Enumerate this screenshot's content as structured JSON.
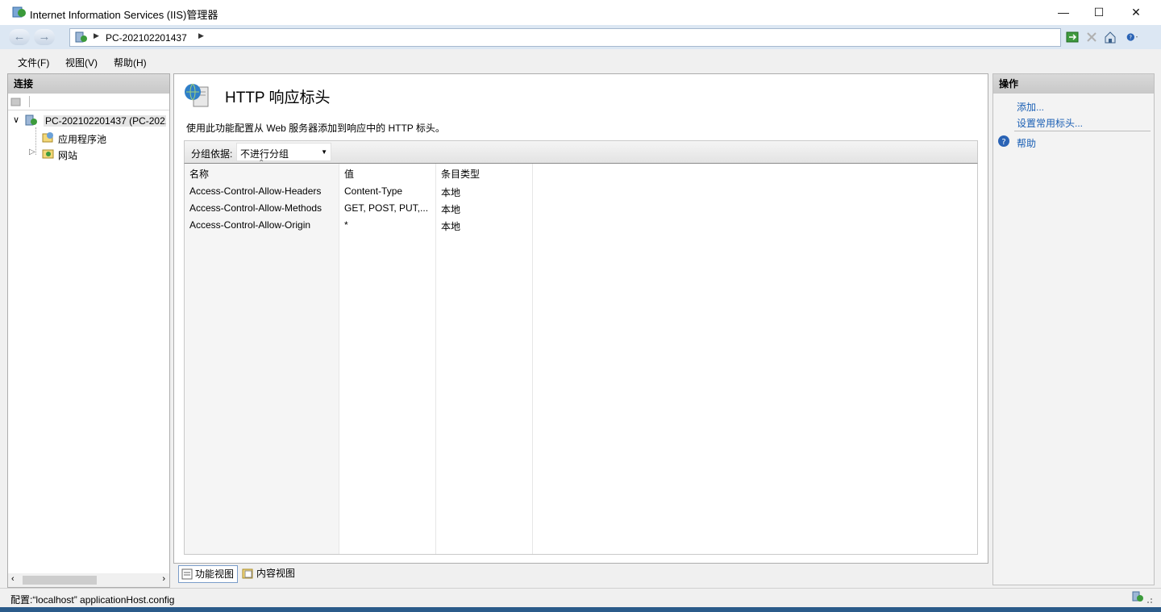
{
  "window": {
    "title": "Internet Information Services (IIS)管理器"
  },
  "address": {
    "crumb": "PC-202102201437"
  },
  "menu": {
    "file": "文件(F)",
    "view": "视图(V)",
    "help": "帮助(H)"
  },
  "connections": {
    "header": "连接",
    "tree": [
      {
        "label": "PC-202102201437 (PC-2021"
      },
      {
        "label": "应用程序池"
      },
      {
        "label": "网站"
      }
    ]
  },
  "feature": {
    "title": "HTTP 响应标头",
    "description": "使用此功能配置从 Web 服务器添加到响应中的 HTTP 标头。",
    "group_label": "分组依据:",
    "group_value": "不进行分组",
    "columns": [
      "名称",
      "值",
      "条目类型"
    ],
    "rows": [
      {
        "name": "Access-Control-Allow-Headers",
        "value": "Content-Type",
        "type": "本地"
      },
      {
        "name": "Access-Control-Allow-Methods",
        "value": "GET, POST, PUT,...",
        "type": "本地"
      },
      {
        "name": "Access-Control-Allow-Origin",
        "value": "*",
        "type": "本地"
      }
    ]
  },
  "views": {
    "features": "功能视图",
    "content": "内容视图"
  },
  "actions": {
    "header": "操作",
    "add": "添加...",
    "common": "设置常用标头...",
    "help": "帮助"
  },
  "status": {
    "text": "配置:“localhost” applicationHost.config"
  },
  "colors": {
    "link": "#1a5fb4",
    "address_bg": "#dce7f3",
    "panel_header": "#c8c8c8"
  }
}
